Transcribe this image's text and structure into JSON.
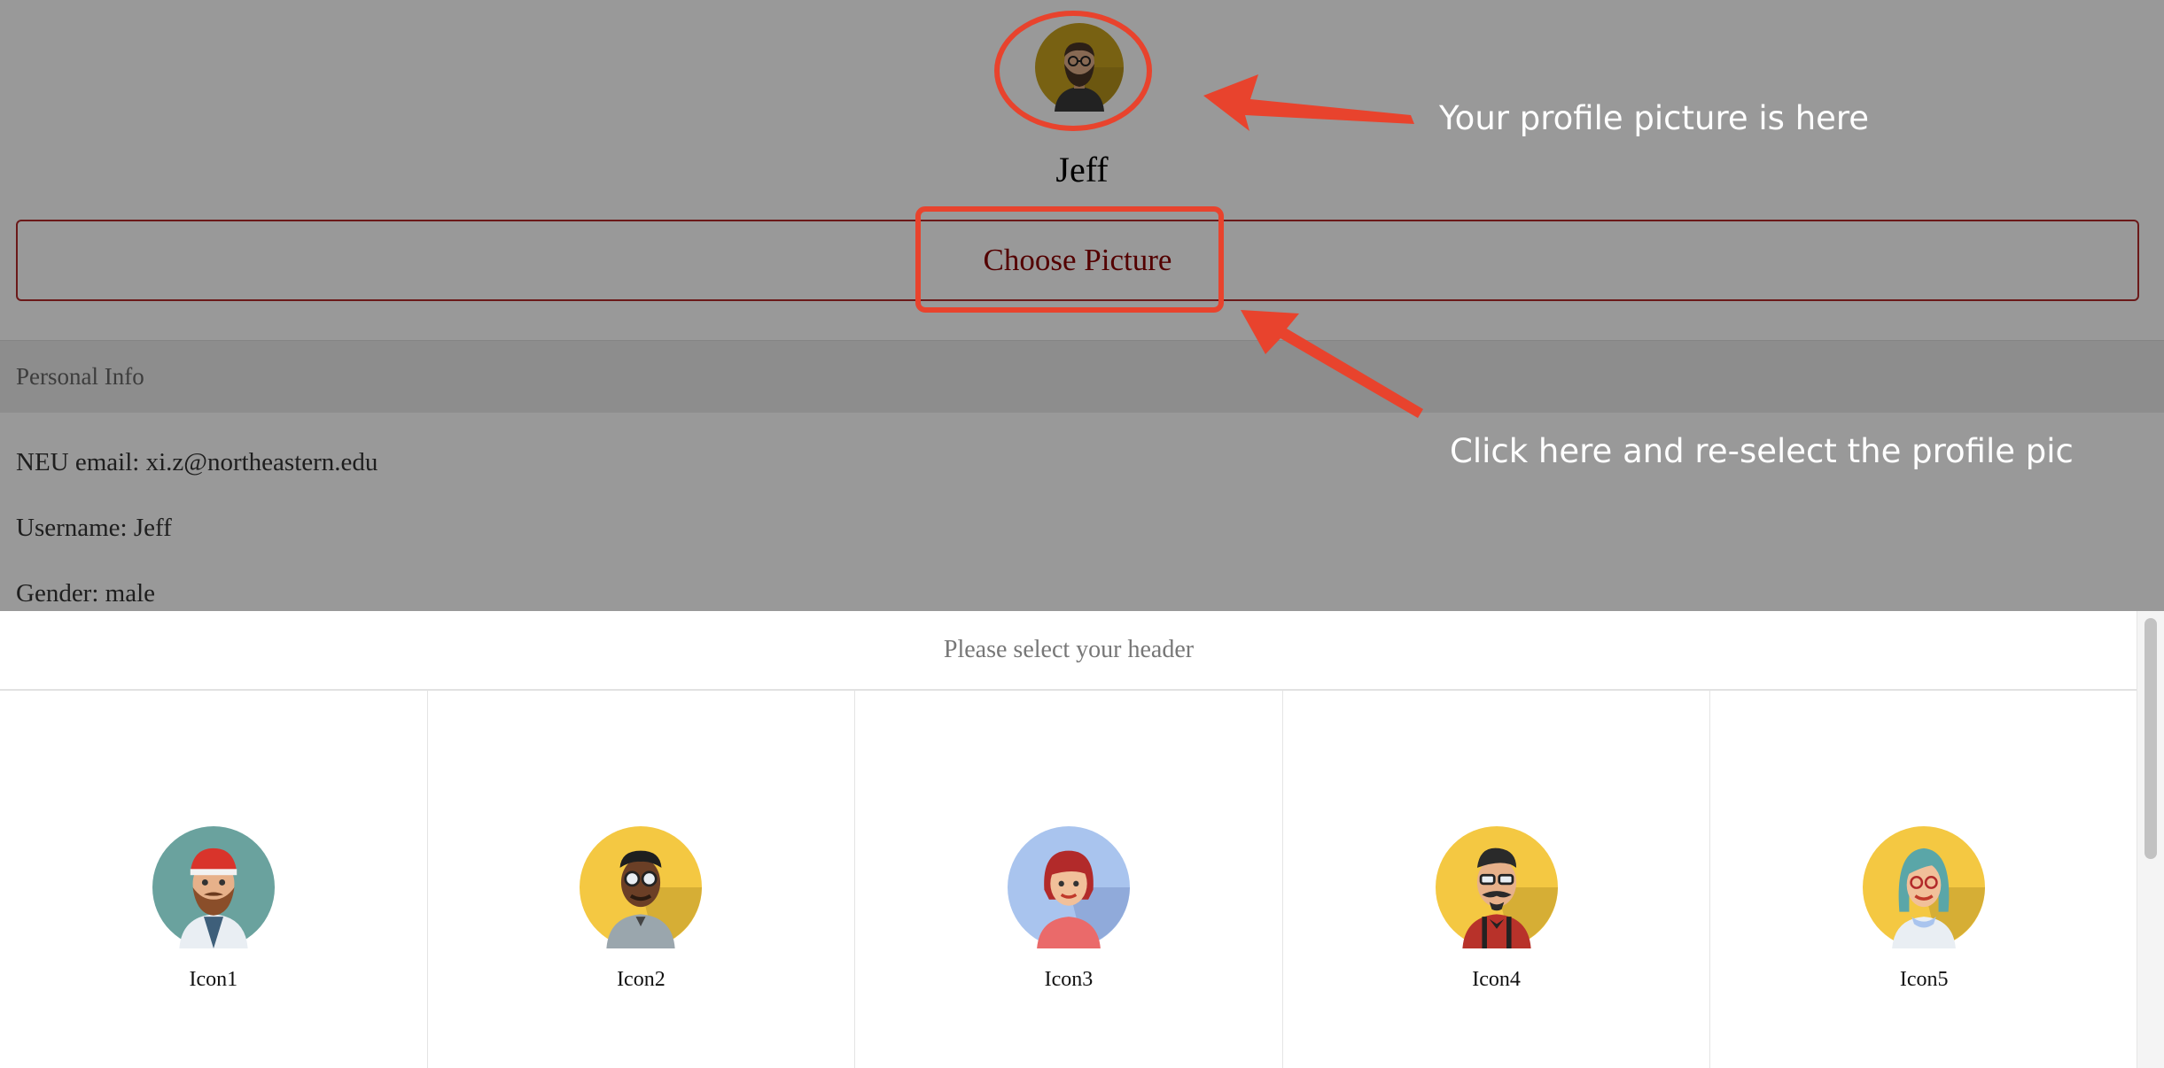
{
  "profile": {
    "username": "Jeff",
    "choose_button_label": "Choose Picture",
    "section_title": "Personal Info",
    "info": [
      "NEU email: xi.z@northeastern.edu",
      "Username: Jeff",
      "Gender: male"
    ]
  },
  "annotations": {
    "profile_picture_note": "Your profile picture is here",
    "choose_picture_note": "Click here and re-select the profile pic",
    "color": "#e8432d"
  },
  "picker": {
    "title": "Please select your header",
    "icons": [
      {
        "label": "Icon1",
        "avatar": "bearded-man-red-cap-avatar",
        "bg": "#6aa29e"
      },
      {
        "label": "Icon2",
        "avatar": "man-glasses-avatar",
        "bg": "#f4c842"
      },
      {
        "label": "Icon3",
        "avatar": "red-haired-woman-avatar",
        "bg": "#a9c4ee"
      },
      {
        "label": "Icon4",
        "avatar": "mustache-man-suspenders-avatar",
        "bg": "#f4c842"
      },
      {
        "label": "Icon5",
        "avatar": "teal-haired-woman-avatar",
        "bg": "#f4c842"
      }
    ]
  }
}
